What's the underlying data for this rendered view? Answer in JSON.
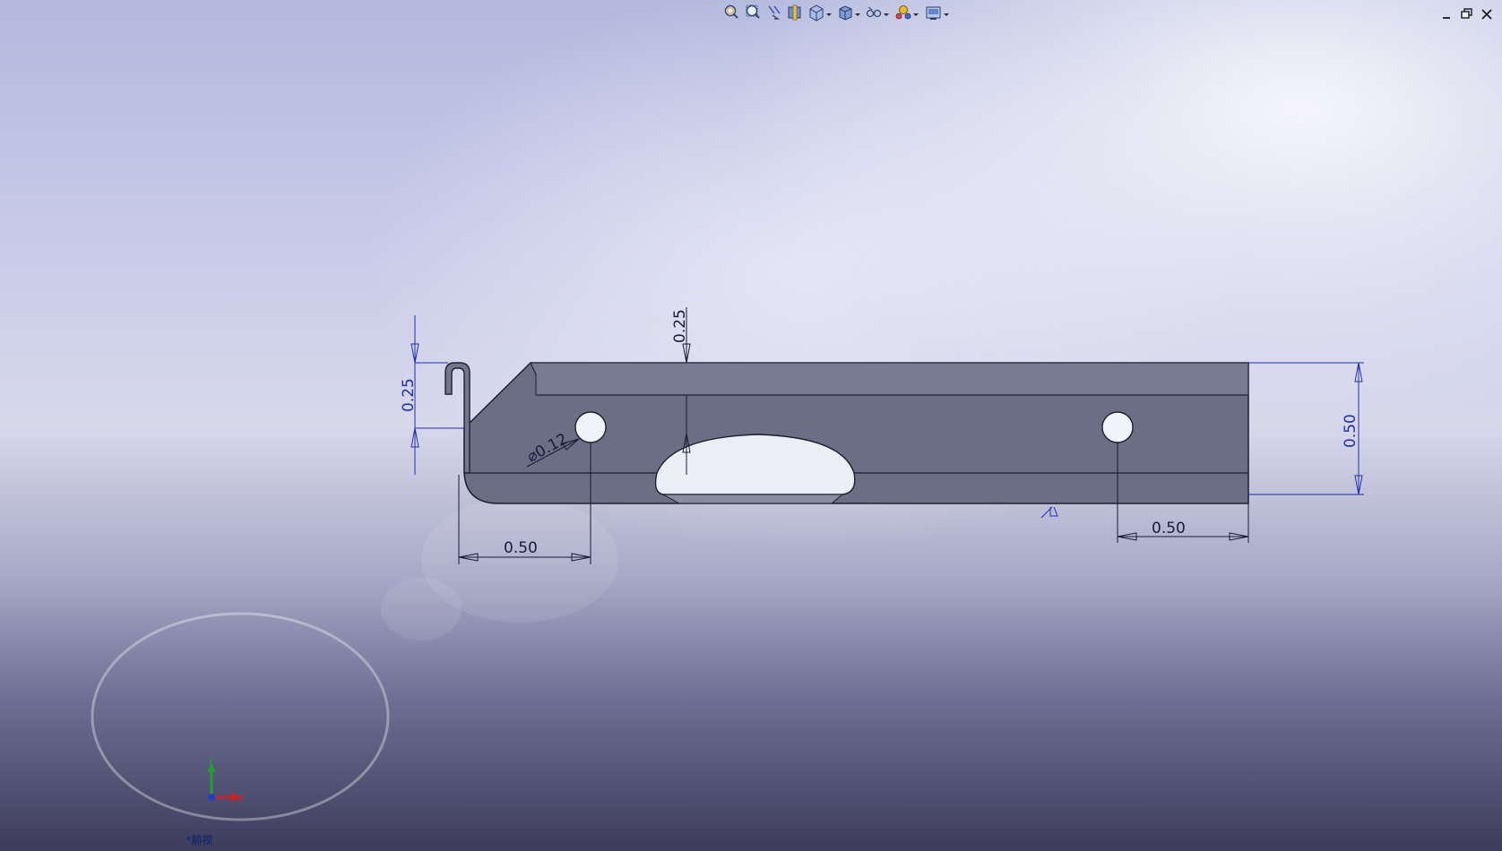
{
  "toolbar": {
    "items": [
      {
        "icon": "zoom-to-fit-icon"
      },
      {
        "icon": "zoom-to-area-icon"
      },
      {
        "icon": "previous-view-icon"
      },
      {
        "icon": "section-view-icon"
      },
      {
        "icon": "view-orientation-icon",
        "dropdown": true
      },
      {
        "icon": "display-style-icon",
        "dropdown": true
      },
      {
        "icon": "hide-show-items-icon",
        "dropdown": true
      },
      {
        "icon": "edit-appearance-icon",
        "dropdown": true
      },
      {
        "icon": "apply-scene-icon",
        "dropdown": true
      }
    ]
  },
  "window_controls": {
    "minimize": "–",
    "restore": "🗗",
    "close": "✕"
  },
  "dimensions": {
    "hook_height": "0.25",
    "flange_depth": "0.25",
    "hole_diameter": "⌀0.12",
    "left_hole_offset": "0.50",
    "right_hole_offset": "0.50",
    "part_height": "0.50"
  },
  "triad": {
    "x_label": "X",
    "y_label": "Y"
  },
  "view_name": "*前视",
  "colors": {
    "part_fill": "#6b6e84",
    "part_edge": "#1e2030",
    "dimension_blue": "#1f2fb8",
    "axis_x": "#d02020",
    "axis_y": "#20a030",
    "axis_z": "#2040d0"
  }
}
